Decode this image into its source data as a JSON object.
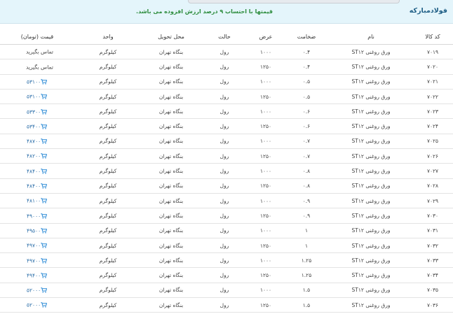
{
  "brand": "فولادمبارکه",
  "notice": "قیمتها با احتساب ۹ درصد ارزش افزوده می باشد.",
  "columns": {
    "code": "کد کالا",
    "name": "نام",
    "thickness": "ضخامت",
    "width": "عرض",
    "state": "حالت",
    "location": "محل تحویل",
    "unit": "واحد",
    "price": "قیمت (تومان)"
  },
  "icons": {
    "cart": "cart-icon"
  },
  "colors": {
    "header_bg": "#e4f5fb",
    "brand": "#1f5f86",
    "notice": "#2c8c3c",
    "price": "#2a6da8"
  },
  "rows": [
    {
      "code": "۷۰۱۹",
      "name": "ورق روغنی ST۱۲",
      "thickness": "۰.۴",
      "width": "۱۰۰۰",
      "state": "رول",
      "location": "بنگاه تهران",
      "unit": "کیلوگرم",
      "price": "تماس بگیرید",
      "has_cart": false
    },
    {
      "code": "۷۰۲۰",
      "name": "ورق روغنی ST۱۲",
      "thickness": "۰.۴",
      "width": "۱۲۵۰",
      "state": "رول",
      "location": "بنگاه تهران",
      "unit": "کیلوگرم",
      "price": "تماس بگیرید",
      "has_cart": false
    },
    {
      "code": "۷۰۲۱",
      "name": "ورق روغنی ST۱۲",
      "thickness": "۰.۵",
      "width": "۱۰۰۰",
      "state": "رول",
      "location": "بنگاه تهران",
      "unit": "کیلوگرم",
      "price": "۵۳۱۰۰",
      "has_cart": true
    },
    {
      "code": "۷۰۲۲",
      "name": "ورق روغنی ST۱۲",
      "thickness": "۰.۵",
      "width": "۱۲۵۰",
      "state": "رول",
      "location": "بنگاه تهران",
      "unit": "کیلوگرم",
      "price": "۵۳۱۰۰",
      "has_cart": true
    },
    {
      "code": "۷۰۲۳",
      "name": "ورق روغنی ST۱۲",
      "thickness": "۰.۶",
      "width": "۱۰۰۰",
      "state": "رول",
      "location": "بنگاه تهران",
      "unit": "کیلوگرم",
      "price": "۵۳۳۰۰",
      "has_cart": true
    },
    {
      "code": "۷۰۲۴",
      "name": "ورق روغنی ST۱۲",
      "thickness": "۰.۶",
      "width": "۱۲۵۰",
      "state": "رول",
      "location": "بنگاه تهران",
      "unit": "کیلوگرم",
      "price": "۵۳۴۰۰",
      "has_cart": true
    },
    {
      "code": "۷۰۲۵",
      "name": "ورق روغنی ST۱۲",
      "thickness": "۰.۷",
      "width": "۱۰۰۰",
      "state": "رول",
      "location": "بنگاه تهران",
      "unit": "کیلوگرم",
      "price": "۴۸۷۰۰",
      "has_cart": true
    },
    {
      "code": "۷۰۲۶",
      "name": "ورق روغنی ST۱۲",
      "thickness": "۰.۷",
      "width": "۱۲۵۰",
      "state": "رول",
      "location": "بنگاه تهران",
      "unit": "کیلوگرم",
      "price": "۴۸۲۰۰",
      "has_cart": true
    },
    {
      "code": "۷۰۲۷",
      "name": "ورق روغنی ST۱۲",
      "thickness": "۰.۸",
      "width": "۱۰۰۰",
      "state": "رول",
      "location": "بنگاه تهران",
      "unit": "کیلوگرم",
      "price": "۴۸۴۰۰",
      "has_cart": true
    },
    {
      "code": "۷۰۲۸",
      "name": "ورق روغنی ST۱۲",
      "thickness": "۰.۸",
      "width": "۱۲۵۰",
      "state": "رول",
      "location": "بنگاه تهران",
      "unit": "کیلوگرم",
      "price": "۴۸۴۰۰",
      "has_cart": true
    },
    {
      "code": "۷۰۲۹",
      "name": "ورق روغنی ST۱۲",
      "thickness": "۰.۹",
      "width": "۱۰۰۰",
      "state": "رول",
      "location": "بنگاه تهران",
      "unit": "کیلوگرم",
      "price": "۴۸۱۰۰",
      "has_cart": true
    },
    {
      "code": "۷۰۳۰",
      "name": "ورق روغنی ST۱۲",
      "thickness": "۰.۹",
      "width": "۱۲۵۰",
      "state": "رول",
      "location": "بنگاه تهران",
      "unit": "کیلوگرم",
      "price": "۴۹۰۰۰",
      "has_cart": true
    },
    {
      "code": "۷۰۳۱",
      "name": "ورق روغنی ST۱۲",
      "thickness": "۱",
      "width": "۱۰۰۰",
      "state": "رول",
      "location": "بنگاه تهران",
      "unit": "کیلوگرم",
      "price": "۴۹۵۰۰",
      "has_cart": true
    },
    {
      "code": "۷۰۳۲",
      "name": "ورق روغنی ST۱۲",
      "thickness": "۱",
      "width": "۱۲۵۰",
      "state": "رول",
      "location": "بنگاه تهران",
      "unit": "کیلوگرم",
      "price": "۴۹۷۰۰",
      "has_cart": true
    },
    {
      "code": "۷۰۳۳",
      "name": "ورق روغنی ST۱۲",
      "thickness": "۱.۲۵",
      "width": "۱۰۰۰",
      "state": "رول",
      "location": "بنگاه تهران",
      "unit": "کیلوگرم",
      "price": "۴۹۷۰۰",
      "has_cart": true
    },
    {
      "code": "۷۰۳۴",
      "name": "ورق روغنی ST۱۲",
      "thickness": "۱.۲۵",
      "width": "۱۲۵۰",
      "state": "رول",
      "location": "بنگاه تهران",
      "unit": "کیلوگرم",
      "price": "۴۹۴۰۰",
      "has_cart": true
    },
    {
      "code": "۷۰۳۵",
      "name": "ورق روغنی ST۱۲",
      "thickness": "۱.۵",
      "width": "۱۰۰۰",
      "state": "رول",
      "location": "بنگاه تهران",
      "unit": "کیلوگرم",
      "price": "۵۲۰۰۰",
      "has_cart": true
    },
    {
      "code": "۷۰۳۶",
      "name": "ورق روغنی ST۱۲",
      "thickness": "۱.۵",
      "width": "۱۲۵۰",
      "state": "رول",
      "location": "بنگاه تهران",
      "unit": "کیلوگرم",
      "price": "۵۲۰۰۰",
      "has_cart": true
    }
  ]
}
